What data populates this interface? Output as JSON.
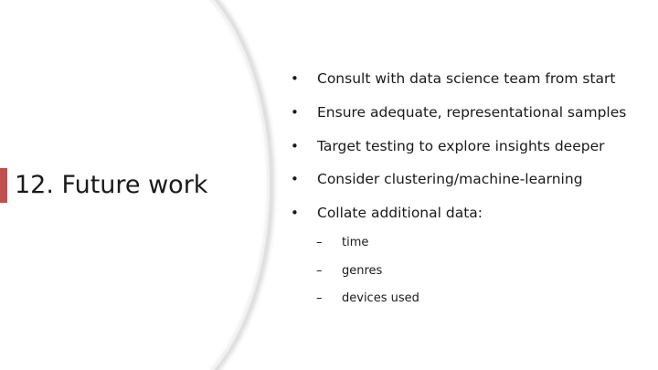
{
  "slide": {
    "title": "12. Future work",
    "accent_color": "#c0504d",
    "bullet_marker": "•",
    "sub_bullet_marker": "–",
    "bullets": [
      "Consult with data science team from start",
      "Ensure adequate, representational samples",
      "Target testing to explore insights deeper",
      "Consider clustering/machine-learning",
      "Collate additional data:"
    ],
    "sub_bullets": [
      "time",
      "genres",
      "devices used"
    ]
  }
}
